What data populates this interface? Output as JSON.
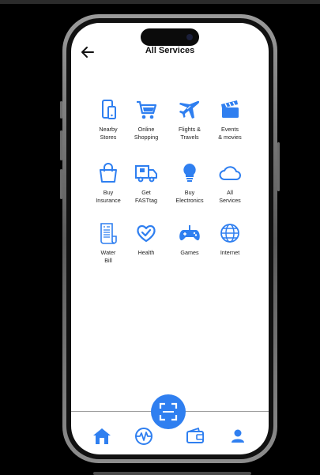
{
  "header": {
    "title": "All Services"
  },
  "services": [
    {
      "label": "Nearby\nStores",
      "icon": "mobile-phone-icon"
    },
    {
      "label": "Online\nShopping",
      "icon": "shopping-cart-icon"
    },
    {
      "label": "Flights &\nTravels",
      "icon": "airplane-icon"
    },
    {
      "label": "Events\n& movies",
      "icon": "clapperboard-icon"
    },
    {
      "label": "Buy\nInsurance",
      "icon": "shopping-bag-icon"
    },
    {
      "label": "Get\nFASTtag",
      "icon": "delivery-truck-icon"
    },
    {
      "label": "Buy\nElectronics",
      "icon": "light-bulb-icon"
    },
    {
      "label": "All\nServices",
      "icon": "cloud-icon"
    },
    {
      "label": "Water\nBill",
      "icon": "receipt-icon"
    },
    {
      "label": "Health",
      "icon": "heart-check-icon"
    },
    {
      "label": "Games",
      "icon": "gamepad-icon"
    },
    {
      "label": "Internet",
      "icon": "globe-icon"
    }
  ],
  "bottom_nav": [
    {
      "icon": "home-icon",
      "active": true
    },
    {
      "icon": "activity-icon",
      "active": false
    },
    {
      "icon": "wallet-icon",
      "active": false
    },
    {
      "icon": "user-icon",
      "active": false
    }
  ],
  "scan_button": {
    "icon": "scan-icon"
  },
  "colors": {
    "accent": "#2f7ff0",
    "background": "#ffffff",
    "text": "#222222"
  }
}
